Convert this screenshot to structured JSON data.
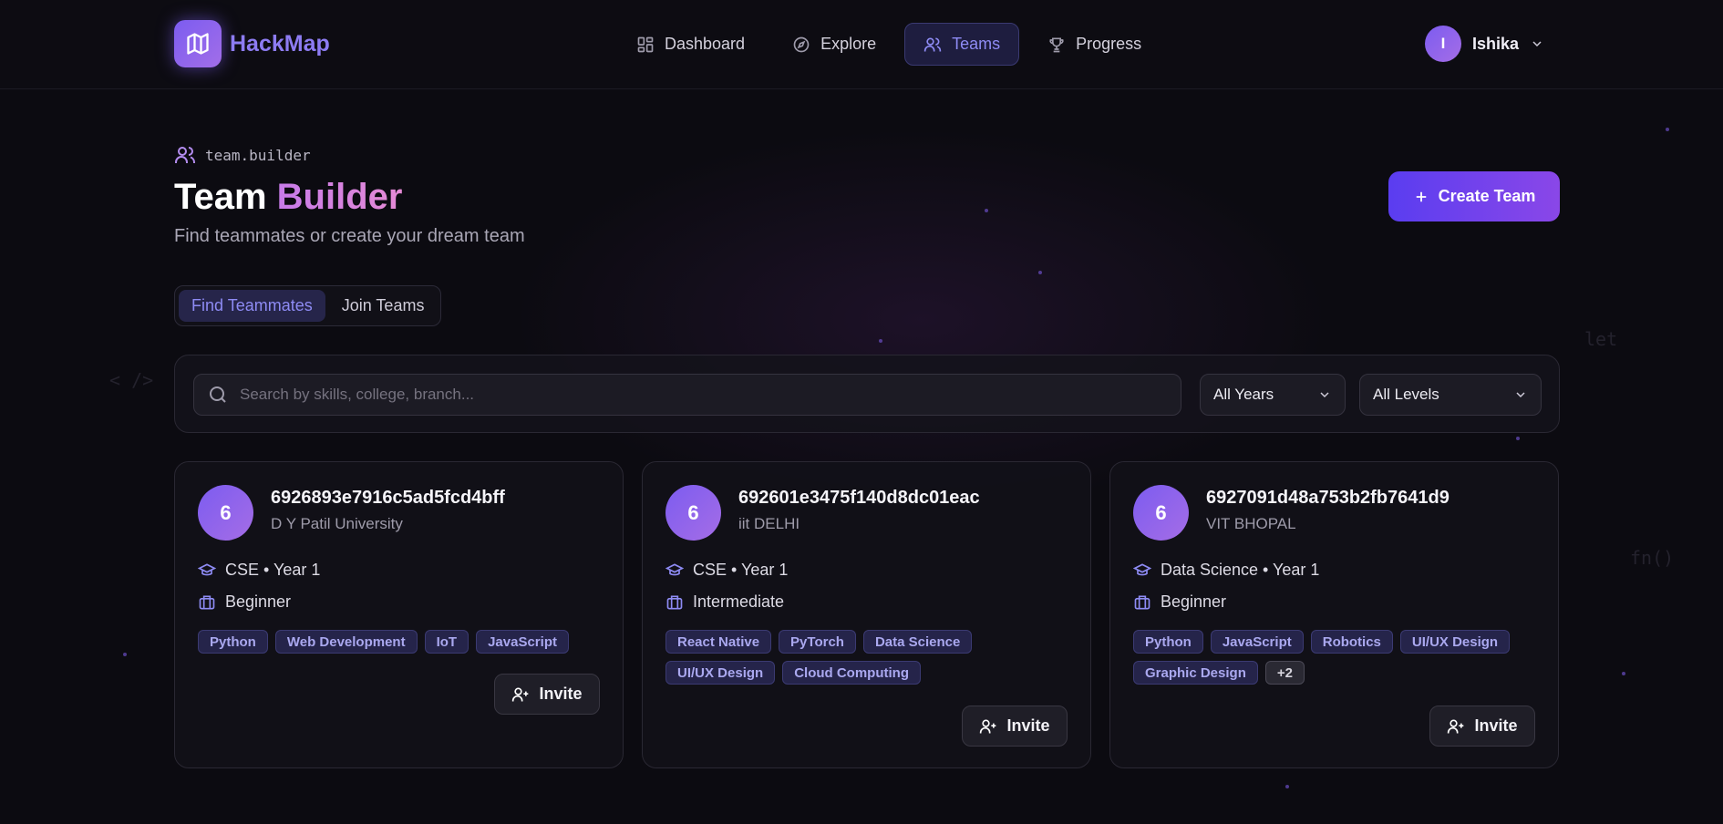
{
  "app": {
    "name": "HackMap"
  },
  "nav": {
    "links": [
      {
        "label": "Dashboard",
        "icon": "grid-icon"
      },
      {
        "label": "Explore",
        "icon": "compass-icon"
      },
      {
        "label": "Teams",
        "icon": "users-icon",
        "active": true
      },
      {
        "label": "Progress",
        "icon": "trophy-icon"
      }
    ],
    "user": {
      "initial": "I",
      "name": "Ishika"
    }
  },
  "header": {
    "breadcrumb": "team.builder",
    "title_plain": "Team ",
    "title_accent": "Builder",
    "subtitle": "Find teammates or create your dream team",
    "create_button": "Create Team"
  },
  "tabs": [
    {
      "label": "Find Teammates",
      "active": true
    },
    {
      "label": "Join Teams",
      "active": false
    }
  ],
  "filters": {
    "search_placeholder": "Search by skills, college, branch...",
    "years": "All Years",
    "levels": "All Levels"
  },
  "cards": [
    {
      "initial": "6",
      "id": "6926893e7916c5ad5fcd4bff",
      "college": "D Y Patil University",
      "branch_year": "CSE • Year 1",
      "level": "Beginner",
      "tags": [
        "Python",
        "Web Development",
        "IoT",
        "JavaScript"
      ],
      "more": "",
      "invite": "Invite"
    },
    {
      "initial": "6",
      "id": "692601e3475f140d8dc01eac",
      "college": "iit DELHI",
      "branch_year": "CSE • Year 1",
      "level": "Intermediate",
      "tags": [
        "React Native",
        "PyTorch",
        "Data Science",
        "UI/UX Design",
        "Cloud Computing"
      ],
      "more": "",
      "invite": "Invite"
    },
    {
      "initial": "6",
      "id": "6927091d48a753b2fb7641d9",
      "college": "VIT BHOPAL",
      "branch_year": "Data Science • Year 1",
      "level": "Beginner",
      "tags": [
        "Python",
        "JavaScript",
        "Robotics",
        "UI/UX Design",
        "Graphic Design"
      ],
      "more": "+2",
      "invite": "Invite"
    }
  ],
  "decor": {
    "code_left": "< />",
    "code_right_1": "let",
    "code_right_2": "fn()"
  },
  "colors": {
    "accent": "#7c5cf0",
    "background": "#0c0b11",
    "tag_text": "#aaa8ef"
  }
}
